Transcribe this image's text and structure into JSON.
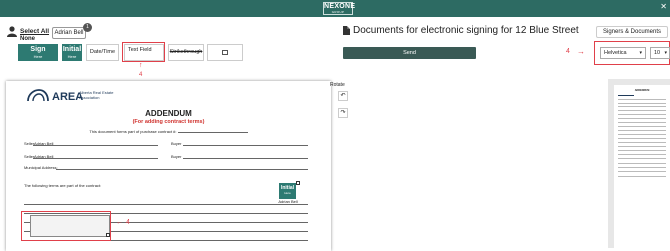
{
  "app": {
    "brand": "NEXONE",
    "brand_sub": "GROUP",
    "close_glyph": "✕"
  },
  "signer": {
    "select_all": "Select All",
    "none": "None",
    "name": "Adrian Bell",
    "badge": "1"
  },
  "toolbar": {
    "sign": {
      "label": "Sign",
      "sub": "Here"
    },
    "initial": {
      "label": "Initial",
      "sub": "Here"
    },
    "datetime": "Date/Time",
    "textfield": "Text Field",
    "strikethrough": "Strikethrough"
  },
  "annotations": {
    "arrow_glyph_up": "↑",
    "arrow_glyph_right": "→",
    "arrow_glyph_left": "←",
    "number": "4"
  },
  "document": {
    "title": "Documents for electronic signing for 12 Blue Street",
    "send_label": "Send",
    "signers_docs_label": "Signers & Documents",
    "font_value": "Helvetica",
    "size_value": "10",
    "rotate_label": "Rotate",
    "rotate_left_glyph": "↶",
    "rotate_right_glyph": "↷"
  },
  "page": {
    "logo_text": "AREA",
    "logo_sub": "Alberta Real Estate Association",
    "heading": "ADDENDUM",
    "subheading": "(For adding contract terms)",
    "form_line": "This document forms part of purchase contract #:",
    "seller1": "Seller",
    "seller2": "Seller",
    "seller_name1": "Adrian Bell",
    "seller_name2": "Adrian Bell",
    "buyer1": "Buyer",
    "buyer2": "Buyer",
    "municipal": "Municipal Address:",
    "terms": "The following terms are part of the contract:",
    "initial_label": "Initial",
    "initial_sub": "Here",
    "initial_name": "Adrian Bell"
  },
  "thumbnail": {
    "title": "ADDENDUM"
  },
  "colors": {
    "brand": "#2d6b63",
    "button_green": "#2d7a72",
    "annotation": "#e0404a",
    "send": "#3a5a55"
  }
}
